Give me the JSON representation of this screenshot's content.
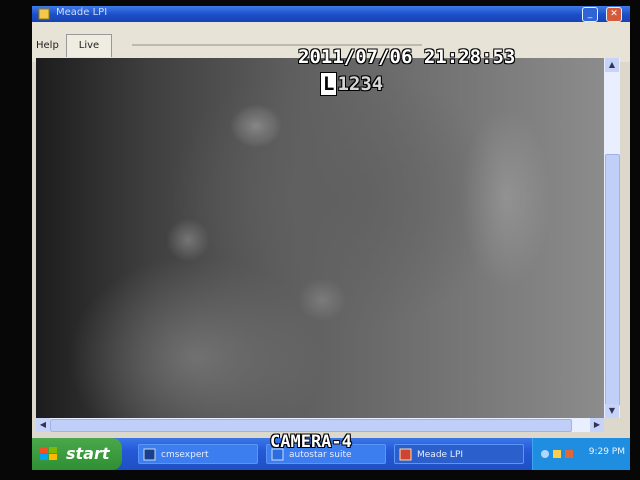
{
  "window": {
    "title": "Meade LPI",
    "menu_help": "Help",
    "tab_live": "Live"
  },
  "osd": {
    "datetime": "2011/07/06 21:28:53",
    "mode_letter": "L",
    "mode_channels": "1234",
    "camera": "CAMERA-4"
  },
  "taskbar": {
    "start_label": "start",
    "items": [
      {
        "label": "cmsexpert"
      },
      {
        "label": "autostar suite"
      },
      {
        "label": "Meade LPI"
      }
    ],
    "clock": "9:29 PM"
  }
}
